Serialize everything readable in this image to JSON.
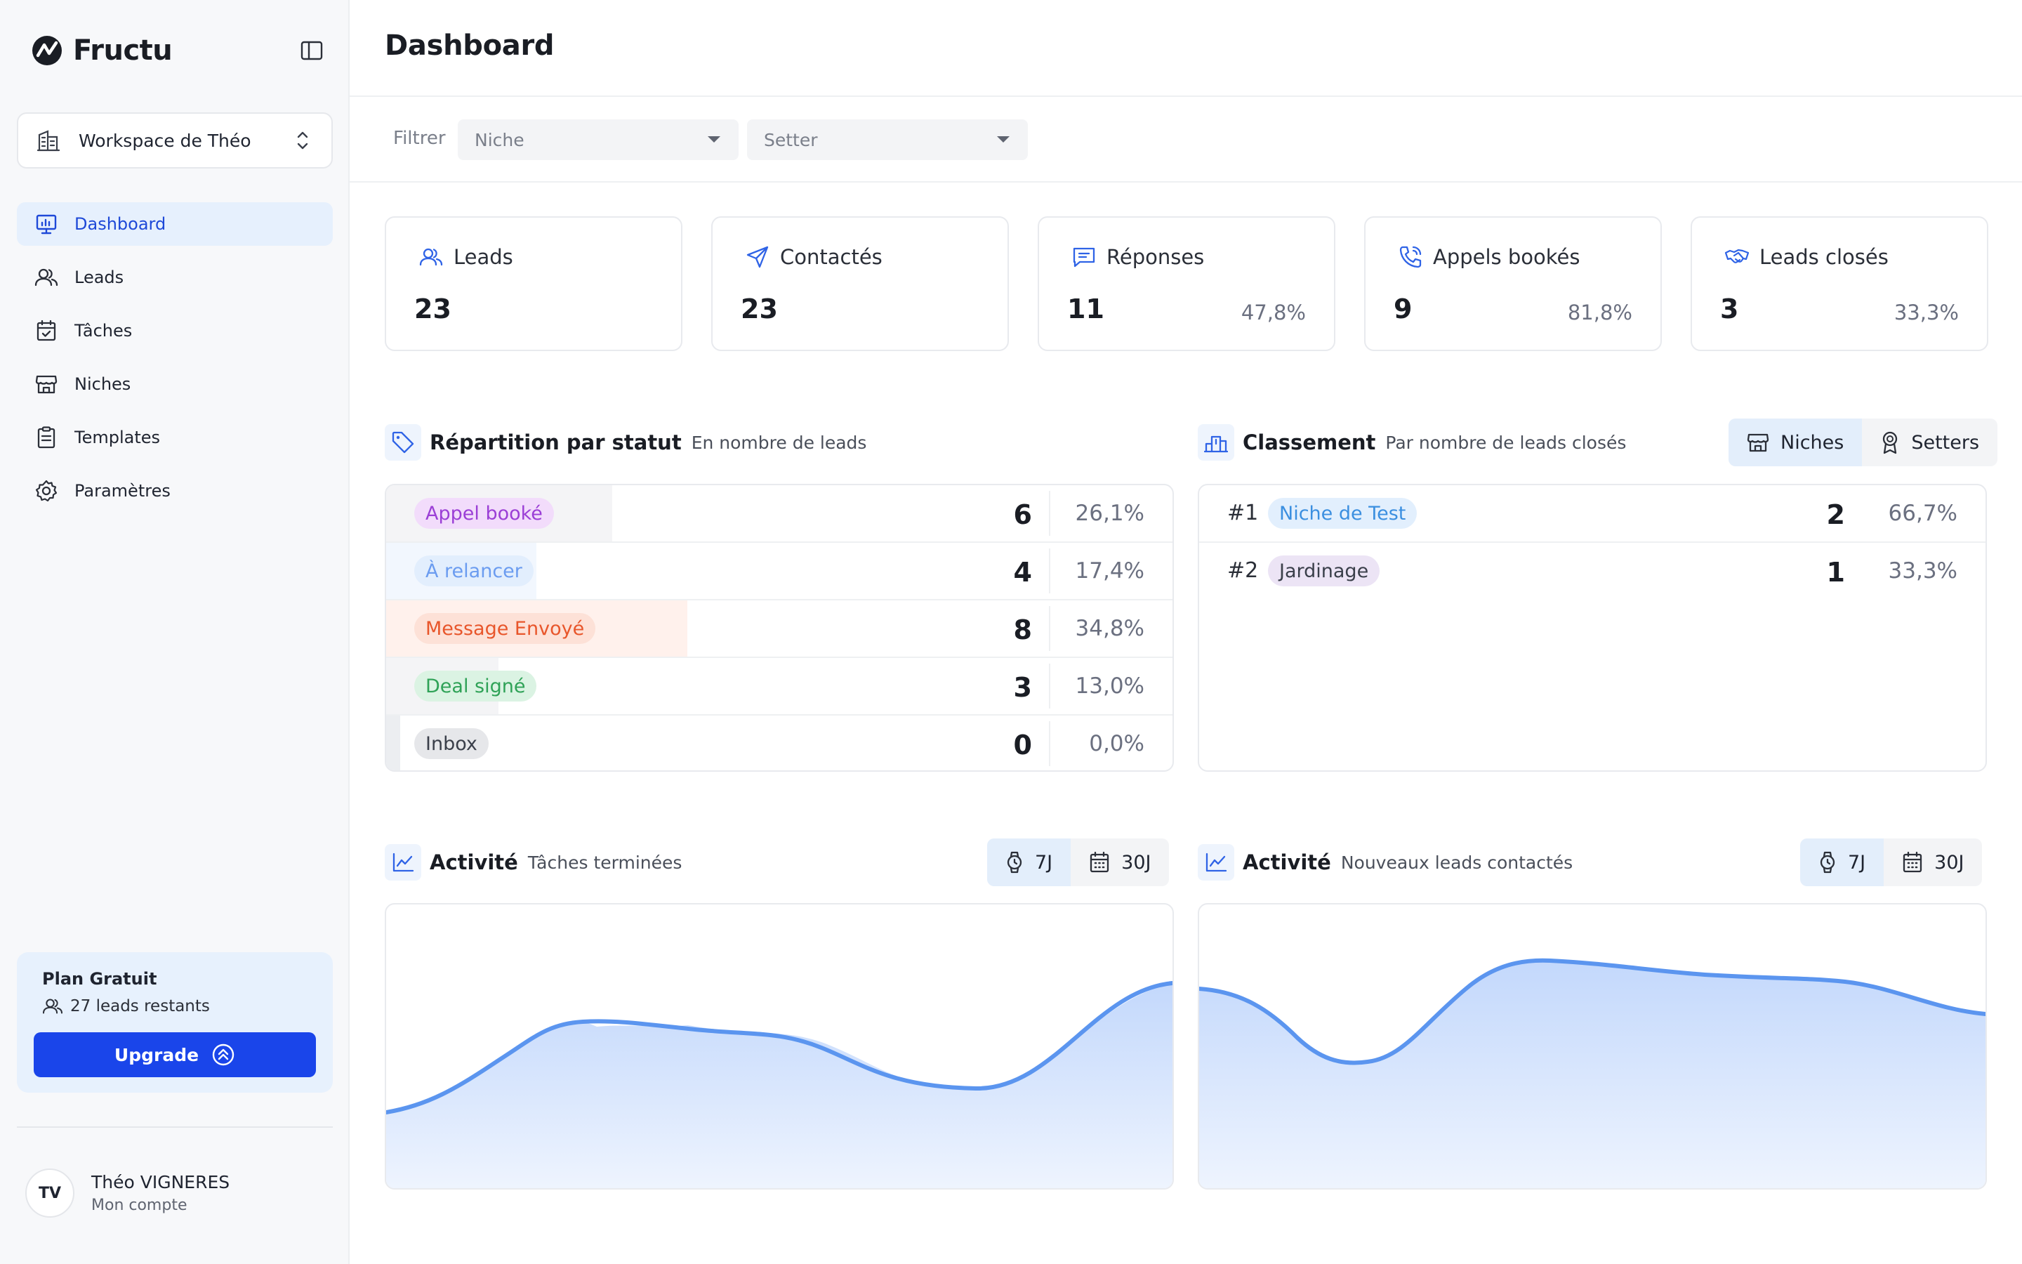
{
  "app": {
    "name": "Fructu"
  },
  "workspace": {
    "name": "Workspace de Théo"
  },
  "nav": [
    {
      "label": "Dashboard",
      "icon": "dashboard-icon",
      "active": true
    },
    {
      "label": "Leads",
      "icon": "users-icon"
    },
    {
      "label": "Tâches",
      "icon": "calendar-check-icon"
    },
    {
      "label": "Niches",
      "icon": "store-icon"
    },
    {
      "label": "Templates",
      "icon": "clipboard-icon"
    },
    {
      "label": "Paramètres",
      "icon": "gear-icon"
    }
  ],
  "plan": {
    "title": "Plan Gratuit",
    "remaining": "27 leads restants",
    "upgrade_label": "Upgrade"
  },
  "user": {
    "initials": "TV",
    "name": "Théo VIGNERES",
    "sub": "Mon compte"
  },
  "page": {
    "title": "Dashboard"
  },
  "filters": {
    "label": "Filtrer",
    "niche_placeholder": "Niche",
    "setter_placeholder": "Setter"
  },
  "kpis": [
    {
      "label": "Leads",
      "value": "23",
      "pct": "",
      "icon": "users-icon"
    },
    {
      "label": "Contactés",
      "value": "23",
      "pct": "",
      "icon": "send-icon"
    },
    {
      "label": "Réponses",
      "value": "11",
      "pct": "47,8%",
      "icon": "message-icon"
    },
    {
      "label": "Appels bookés",
      "value": "9",
      "pct": "81,8%",
      "icon": "phone-call-icon"
    },
    {
      "label": "Leads closés",
      "value": "3",
      "pct": "33,3%",
      "icon": "handshake-icon"
    }
  ],
  "status": {
    "title": "Répartition par statut",
    "subtitle": "En nombre de leads",
    "rows": [
      {
        "label": "Appel booké",
        "count": "6",
        "pct": "26,1%",
        "share": 0.261,
        "text_color": "#9b3fd6",
        "pill_bg": "#f2dcfb",
        "fill_bg": "#f4f4f6"
      },
      {
        "label": "À relancer",
        "count": "4",
        "pct": "17,4%",
        "share": 0.174,
        "text_color": "#6b9cf0",
        "pill_bg": "#e2eefd",
        "fill_bg": "#f2f7fe"
      },
      {
        "label": "Message Envoyé",
        "count": "8",
        "pct": "34,8%",
        "share": 0.348,
        "text_color": "#e8562b",
        "pill_bg": "#fde1d7",
        "fill_bg": "#fff1ec"
      },
      {
        "label": "Deal signé",
        "count": "3",
        "pct": "13,0%",
        "share": 0.13,
        "text_color": "#2fa257",
        "pill_bg": "#dbf3e3",
        "fill_bg": "#f4f4f6"
      },
      {
        "label": "Inbox",
        "count": "0",
        "pct": "0,0%",
        "share": 0.0,
        "text_color": "#3a3f4a",
        "pill_bg": "#e6e7ea",
        "fill_bg": "#eceef1"
      }
    ]
  },
  "ranking": {
    "title": "Classement",
    "subtitle": "Par nombre de leads closés",
    "tabs": [
      {
        "label": "Niches",
        "icon": "store-icon",
        "active": true
      },
      {
        "label": "Setters",
        "icon": "award-icon"
      }
    ],
    "rows": [
      {
        "rank": "#1",
        "label": "Niche de Test",
        "count": "2",
        "pct": "66,7%",
        "text_color": "#3b8fe0",
        "pill_bg": "#e2effd"
      },
      {
        "rank": "#2",
        "label": "Jardinage",
        "count": "1",
        "pct": "33,3%",
        "text_color": "#3a3f4a",
        "pill_bg": "#ece4f5"
      }
    ]
  },
  "activity": [
    {
      "title": "Activité",
      "subtitle": "Tâches terminées",
      "tabs": [
        {
          "label": "7J",
          "icon": "watch-icon",
          "active": true
        },
        {
          "label": "30J",
          "icon": "calendar-icon"
        }
      ]
    },
    {
      "title": "Activité",
      "subtitle": "Nouveaux leads contactés",
      "tabs": [
        {
          "label": "7J",
          "icon": "watch-icon",
          "active": true
        },
        {
          "label": "30J",
          "icon": "calendar-icon"
        }
      ]
    }
  ],
  "colors": {
    "accent": "#1a45ea",
    "chart_line": "#5b95ef",
    "chart_fill_top": "#c6dafc",
    "chart_fill_bottom": "#edf3fe"
  }
}
